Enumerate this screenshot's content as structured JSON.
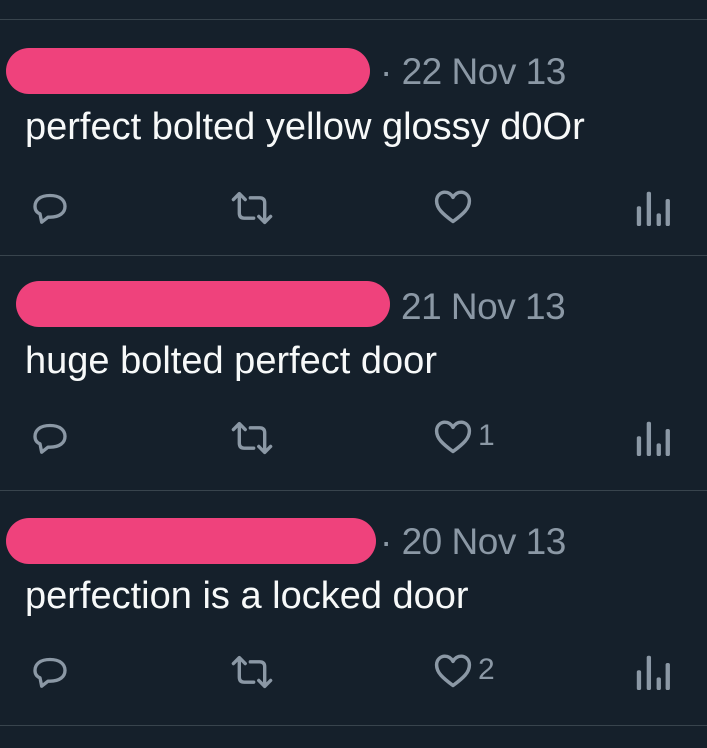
{
  "colors": {
    "background": "#15202b",
    "divider": "#38444d",
    "text": "#f7f9f9",
    "muted": "#8b98a5",
    "redaction": "#ef427c"
  },
  "tweets": [
    {
      "date": "· 22 Nov 13",
      "text": "perfect bolted yellow glossy d0Or",
      "reply_icon": "reply-icon",
      "retweet_icon": "retweet-icon",
      "like_icon": "like-heart-icon",
      "like_count": "",
      "views_icon": "views-bar-chart-icon"
    },
    {
      "date": "21 Nov 13",
      "text": "huge bolted perfect door",
      "reply_icon": "reply-icon",
      "retweet_icon": "retweet-icon",
      "like_icon": "like-heart-icon",
      "like_count": "1",
      "views_icon": "views-bar-chart-icon"
    },
    {
      "date": "· 20 Nov 13",
      "text": "perfection is a locked door",
      "reply_icon": "reply-icon",
      "retweet_icon": "retweet-icon",
      "like_icon": "like-heart-icon",
      "like_count": "2",
      "views_icon": "views-bar-chart-icon"
    }
  ]
}
